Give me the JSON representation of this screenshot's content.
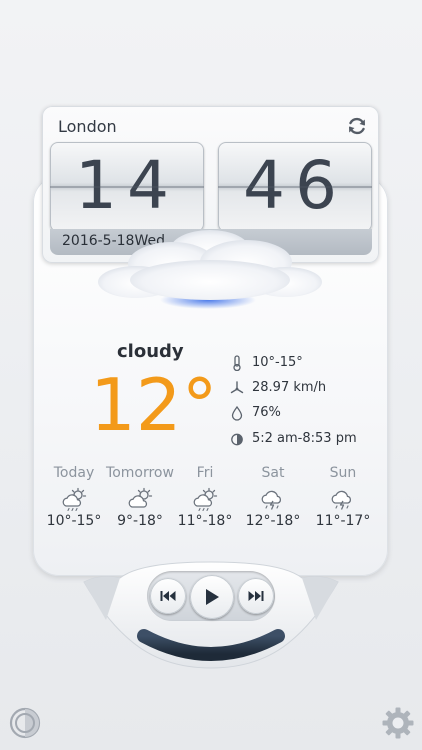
{
  "header": {
    "city": "London"
  },
  "clock": {
    "hours": "14",
    "minutes": "46",
    "date": "2016-5-18Wed"
  },
  "current": {
    "condition": "cloudy",
    "temperature": "12°",
    "stats": {
      "temp_range": "10°-15°",
      "wind": "28.97 km/h",
      "humidity": "76%",
      "sun": "5:2 am-8:53 pm"
    }
  },
  "forecast": [
    {
      "day": "Today",
      "range": "10°-15°",
      "icon": "partly-cloudy-icon"
    },
    {
      "day": "Tomorrow",
      "range": "9°-18°",
      "icon": "partly-cloudy-icon"
    },
    {
      "day": "Fri",
      "range": "11°-18°",
      "icon": "partly-cloudy-icon"
    },
    {
      "day": "Sat",
      "range": "12°-18°",
      "icon": "thunderstorm-icon"
    },
    {
      "day": "Sun",
      "range": "11°-17°",
      "icon": "thunderstorm-icon"
    }
  ],
  "colors": {
    "accent_temp": "#f39a1a",
    "player_dark": "#2a3a4e"
  }
}
